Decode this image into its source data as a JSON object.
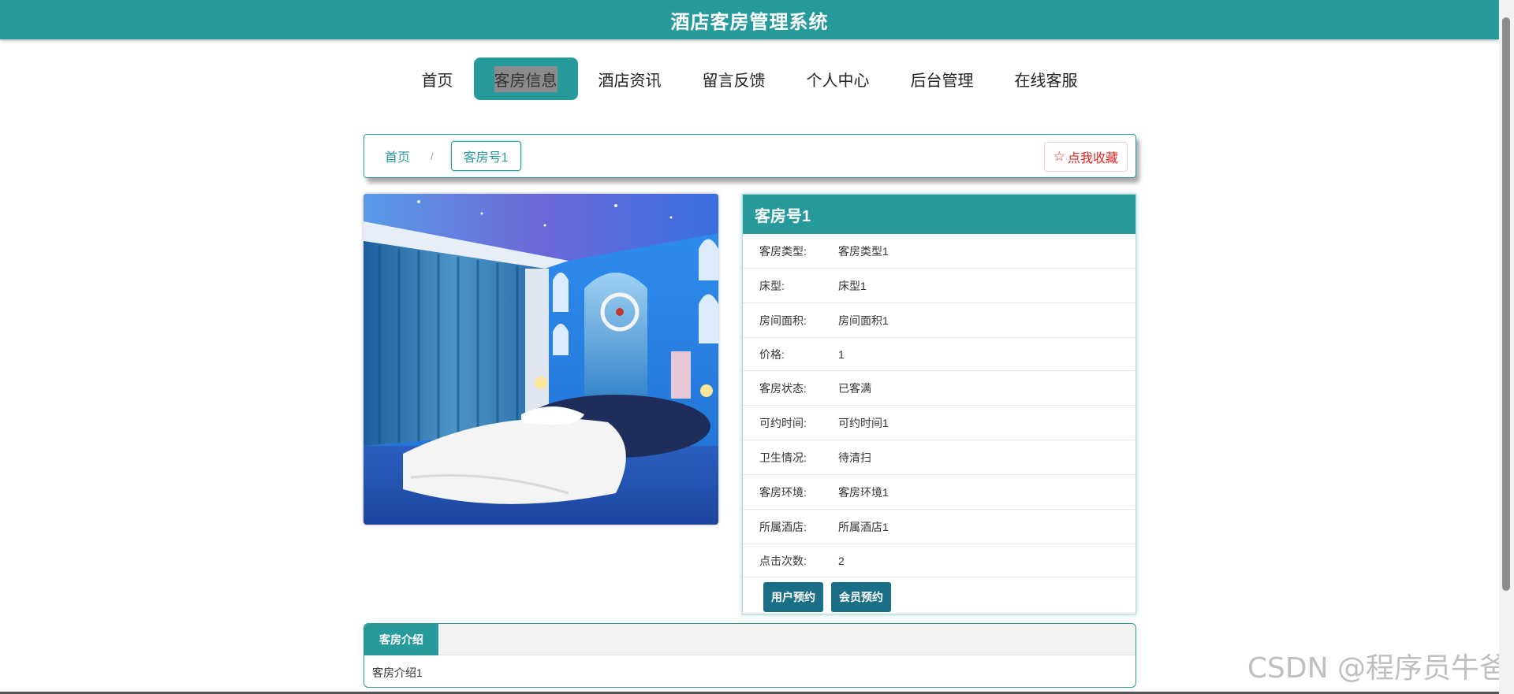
{
  "header": {
    "title": "酒店客房管理系统"
  },
  "nav": {
    "items": [
      {
        "label": "首页",
        "active": false
      },
      {
        "label": "客房信息",
        "active": true
      },
      {
        "label": "酒店资讯",
        "active": false
      },
      {
        "label": "留言反馈",
        "active": false
      },
      {
        "label": "个人中心",
        "active": false
      },
      {
        "label": "后台管理",
        "active": false
      },
      {
        "label": "在线客服",
        "active": false
      }
    ]
  },
  "breadcrumb": {
    "home": "首页",
    "separator": "/",
    "current": "客房号1"
  },
  "favorite": {
    "label": "点我收藏",
    "icon": "star-outline-icon",
    "color": "#e02424"
  },
  "detail": {
    "title": "客房号1",
    "rows": [
      {
        "key": "客房类型:",
        "value": "客房类型1"
      },
      {
        "key": "床型:",
        "value": "床型1"
      },
      {
        "key": "房间面积:",
        "value": "房间面积1"
      },
      {
        "key": "价格:",
        "value": "1"
      },
      {
        "key": "客房状态:",
        "value": "已客满"
      },
      {
        "key": "可约时间:",
        "value": "可约时间1"
      },
      {
        "key": "卫生情况:",
        "value": "待清扫"
      },
      {
        "key": "客房环境:",
        "value": "客房环境1"
      },
      {
        "key": "所属酒店:",
        "value": "所属酒店1"
      },
      {
        "key": "点击次数:",
        "value": "2"
      }
    ],
    "buttons": {
      "user_booking": "用户预约",
      "member_booking": "会员预约"
    }
  },
  "intro": {
    "tab": "客房介绍",
    "content": "客房介绍1"
  },
  "watermark": "CSDN @程序员牛爸",
  "colors": {
    "brand": "#279a9c",
    "button": "#1a6f86"
  }
}
